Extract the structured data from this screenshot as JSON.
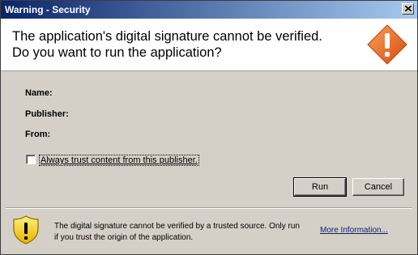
{
  "window": {
    "title": "Warning - Security"
  },
  "header": {
    "line1": "The application's digital signature cannot be verified.",
    "line2": "Do you want to run the application?"
  },
  "details": {
    "name_label": "Name:",
    "publisher_label": "Publisher:",
    "from_label": "From:"
  },
  "trust_checkbox": {
    "label": "Always trust content from this publisher.",
    "checked": false
  },
  "buttons": {
    "run": "Run",
    "cancel": "Cancel"
  },
  "footer": {
    "message": "The digital signature cannot be verified by a trusted source.  Only run if you trust the origin of the application.",
    "more_info": "More Information..."
  },
  "icons": {
    "header_icon": "warning-diamond-icon",
    "footer_icon": "shield-warning-icon",
    "close_icon": "close-icon"
  },
  "colors": {
    "titlebar_start": "#0a246a",
    "titlebar_end": "#a6caf0",
    "warning_orange": "#e8601c",
    "shield_yellow": "#f4c400"
  }
}
